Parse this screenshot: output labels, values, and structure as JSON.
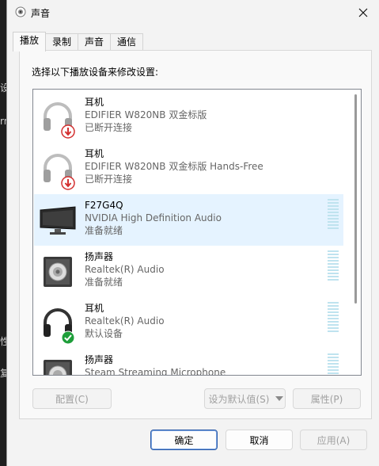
{
  "window": {
    "title": "声音"
  },
  "background_fragments": [
    "设",
    "rn",
    "性",
    "复"
  ],
  "tabs": [
    {
      "label": "播放",
      "active": true
    },
    {
      "label": "录制",
      "active": false
    },
    {
      "label": "声音",
      "active": false
    },
    {
      "label": "通信",
      "active": false
    }
  ],
  "instruction": "选择以下播放设备来修改设置:",
  "devices": [
    {
      "name": "耳机",
      "description": "EDIFIER W820NB 双金标版",
      "status": "已断开连接",
      "icon": "headphones-icon",
      "badge": "disconnected-badge-icon"
    },
    {
      "name": "耳机",
      "description": "EDIFIER W820NB 双金标版 Hands-Free",
      "status": "已断开连接",
      "icon": "headphones-icon",
      "badge": "disconnected-badge-icon"
    },
    {
      "name": "F27G4Q",
      "description": "NVIDIA High Definition Audio",
      "status": "准备就绪",
      "icon": "monitor-icon",
      "selected": true
    },
    {
      "name": "扬声器",
      "description": "Realtek(R) Audio",
      "status": "准备就绪",
      "icon": "speaker-icon"
    },
    {
      "name": "耳机",
      "description": "Realtek(R) Audio",
      "status": "默认设备",
      "icon": "headphones-icon",
      "badge": "default-check-icon"
    },
    {
      "name": "扬声器",
      "description": "Steam Streaming Microphone",
      "status": "",
      "icon": "speaker-icon"
    }
  ],
  "buttons": {
    "configure": "配置(C)",
    "set_default": "设为默认值(S)",
    "properties": "属性(P)",
    "ok": "确定",
    "cancel": "取消",
    "apply": "应用(A)"
  },
  "colors": {
    "selection": "#e5f3ff",
    "meter": "#bfe3ef",
    "accent": "#2a5aa8"
  }
}
